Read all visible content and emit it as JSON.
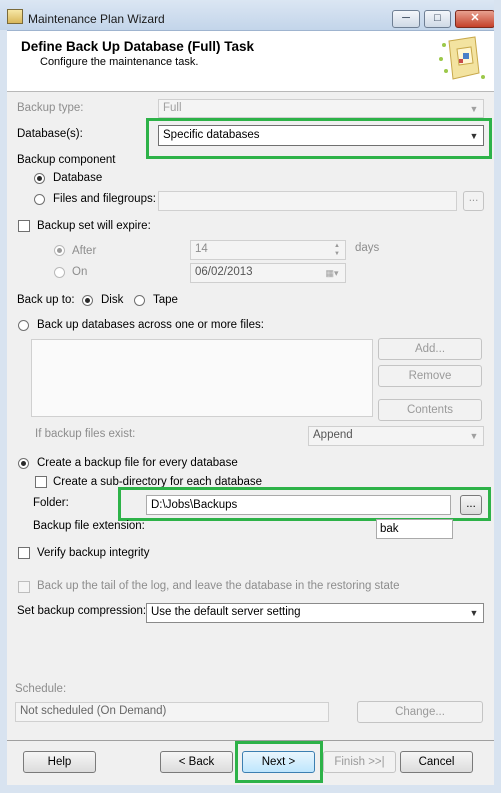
{
  "window": {
    "title": "Maintenance Plan Wizard"
  },
  "header": {
    "title": "Define Back Up Database (Full) Task",
    "subtitle": "Configure the maintenance task."
  },
  "form": {
    "backup_type": {
      "label": "Backup type:",
      "value": "Full"
    },
    "databases": {
      "label": "Database(s):",
      "value": "Specific databases"
    },
    "backup_component": {
      "label": "Backup component",
      "database_option": "Database",
      "files_option": "Files and filegroups:",
      "files_browse": "..."
    },
    "expire": {
      "label": "Backup set will expire:",
      "after_label": "After",
      "after_value": "14",
      "days_label": "days",
      "on_label": "On",
      "on_value": "06/02/2013"
    },
    "backup_to": {
      "label": "Back up to:",
      "disk": "Disk",
      "tape": "Tape"
    },
    "across_files": {
      "label": "Back up databases across one or more files:",
      "add": "Add...",
      "remove": "Remove",
      "contents": "Contents",
      "if_exist_label": "If backup files exist:",
      "if_exist_value": "Append"
    },
    "per_database": {
      "label": "Create a backup file for every database",
      "subdir_label": "Create a sub-directory for each database",
      "folder_label": "Folder:",
      "folder_value": "D:\\Jobs\\Backups",
      "folder_browse": "...",
      "ext_label": "Backup file extension:",
      "ext_value": "bak"
    },
    "verify": {
      "label": "Verify backup integrity"
    },
    "tail_log": {
      "label": "Back up the tail of the log, and leave the database in the restoring state"
    },
    "compression": {
      "label": "Set backup compression:",
      "value": "Use the default server setting"
    },
    "schedule": {
      "label": "Schedule:",
      "value": "Not scheduled (On Demand)",
      "change": "Change..."
    }
  },
  "footer": {
    "help": "Help",
    "back": "< Back",
    "next": "Next >",
    "finish": "Finish >>|",
    "cancel": "Cancel"
  },
  "colors": {
    "highlight": "#2db248"
  }
}
